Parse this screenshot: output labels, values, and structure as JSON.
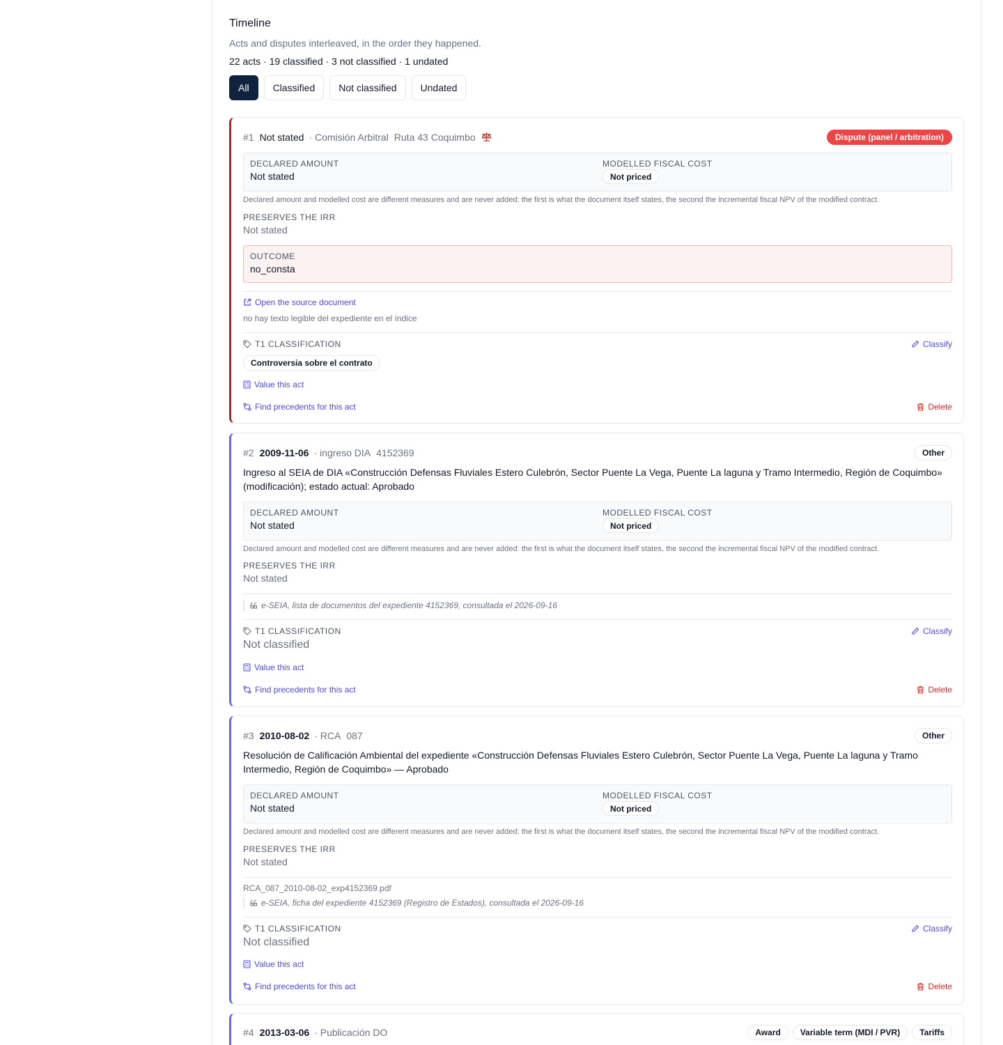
{
  "timeline": {
    "title": "Timeline",
    "subtitle": "Acts and disputes interleaved, in the order they happened.",
    "counts": "22 acts · 19 classified · 3 not classified · 1 undated",
    "filters": [
      "All",
      "Classified",
      "Not classified",
      "Undated"
    ],
    "active_filter": "All"
  },
  "labels": {
    "declared_amount": "DECLARED AMOUNT",
    "modelled_cost": "MODELLED FISCAL COST",
    "preserves_irr": "PRESERVES THE IRR",
    "outcome": "OUTCOME",
    "t1": "T1 CLASSIFICATION",
    "classify": "Classify",
    "value_act": "Value this act",
    "find_precedents": "Find precedents for this act",
    "delete": "Delete",
    "open_source": "Open the source document",
    "measures_note": "Declared amount and modelled cost are different measures and are never added: the first is what the document itself states, the second the incremental fiscal NPV of the modified contract."
  },
  "acts": [
    {
      "num": "#1",
      "date": "Not stated",
      "meta": "· Comisión Arbitral",
      "ref": "Ruta 43 Coquimbo",
      "tags": [
        "Dispute (panel / arbitration)"
      ],
      "declared_amount": "Not stated",
      "modelled_cost": "Not priced",
      "preserves_irr": "Not stated",
      "outcome": "no_consta",
      "source_note": "no hay texto legible del expediente en el índice",
      "classification": "Controversia sobre el contrato"
    },
    {
      "num": "#2",
      "date": "2009-11-06",
      "meta": "· ingreso DIA",
      "ref": "4152369",
      "tags": [
        "Other"
      ],
      "description": "Ingreso al SEIA de DIA «Construcción Defensas Fluviales Estero Culebrón, Sector Puente La Vega, Puente La laguna y Tramo Intermedio, Región de Coquimbo» (modificación); estado actual: Aprobado",
      "declared_amount": "Not stated",
      "modelled_cost": "Not priced",
      "preserves_irr": "Not stated",
      "citation": "e-SEIA, lista de documentos del expediente 4152369, consultada el 2026-09-16",
      "classification": "Not classified"
    },
    {
      "num": "#3",
      "date": "2010-08-02",
      "meta": "· RCA",
      "ref": "087",
      "tags": [
        "Other"
      ],
      "description": "Resolución de Calificación Ambiental del expediente «Construcción Defensas Fluviales Estero Culebrón, Sector Puente La Vega, Puente La laguna y Tramo Intermedio, Región de Coquimbo» — Aprobado",
      "declared_amount": "Not stated",
      "modelled_cost": "Not priced",
      "preserves_irr": "Not stated",
      "file": "RCA_087_2010-08-02_exp4152369.pdf",
      "citation": "e-SEIA, ficha del expediente 4152369 (Registro de Estados), consultada el 2026-09-16",
      "classification": "Not classified"
    },
    {
      "num": "#4",
      "date": "2013-03-06",
      "meta": "· Publicación DO",
      "tags": [
        "Award",
        "Variable term (MDI / PVR)",
        "Tariffs"
      ]
    }
  ],
  "colors": {
    "accent": "#4f46e5",
    "dispute": "#b42323",
    "danger": "#dc2626",
    "dark_button": "#0f233f"
  }
}
